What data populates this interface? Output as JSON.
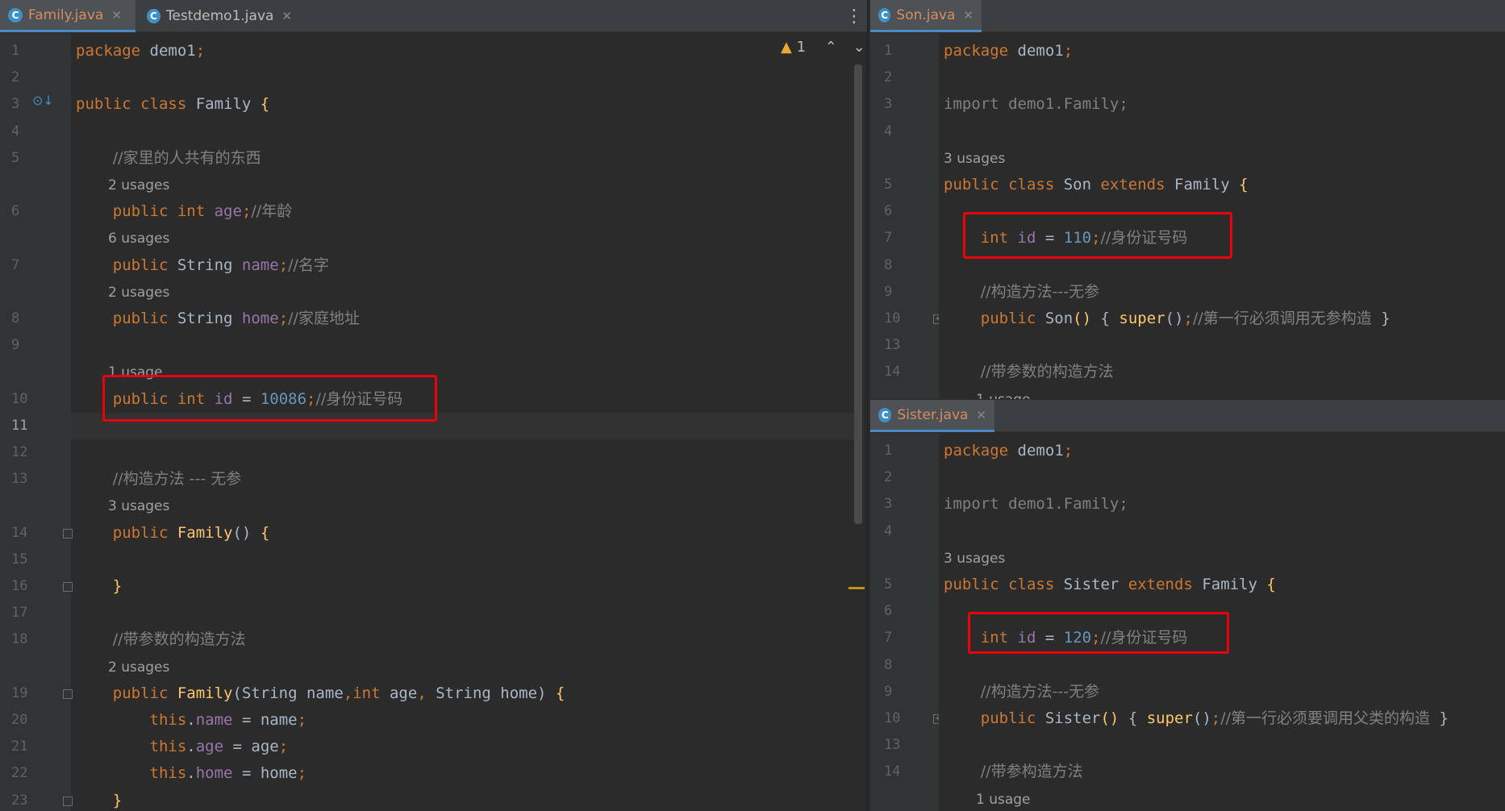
{
  "left_tabs": [
    {
      "name": "Family.java",
      "active": true
    },
    {
      "name": "Testdemo1.java",
      "active": false
    }
  ],
  "son_tab": {
    "name": "Son.java"
  },
  "sister_tab": {
    "name": "Sister.java"
  },
  "icons": {
    "tab": "java-class-icon",
    "close": "close-icon",
    "menu": "more-vertical-icon",
    "warning": "warning-icon"
  },
  "warning_count": "1",
  "family": {
    "lines": [
      {
        "n": "1",
        "code": [
          [
            "kw",
            "package "
          ],
          [
            "t",
            "demo1"
          ],
          [
            "kw",
            ";"
          ]
        ]
      },
      {
        "n": "2",
        "code": []
      },
      {
        "n": "3",
        "code": [
          [
            "kw",
            "public class "
          ],
          [
            "t",
            "Family "
          ],
          [
            "fn",
            "{"
          ]
        ]
      },
      {
        "n": "4",
        "code": []
      },
      {
        "n": "5",
        "code": [
          [
            "t",
            "    "
          ],
          [
            "cm",
            "//家里的人共有的东西"
          ]
        ]
      },
      {
        "hint": "2 usages"
      },
      {
        "n": "6",
        "code": [
          [
            "t",
            "    "
          ],
          [
            "kw",
            "public int "
          ],
          [
            "fld",
            "age"
          ],
          [
            "kw",
            ";"
          ],
          [
            "cm",
            "//年龄"
          ]
        ]
      },
      {
        "hint": "6 usages"
      },
      {
        "n": "7",
        "code": [
          [
            "t",
            "    "
          ],
          [
            "kw",
            "public "
          ],
          [
            "t",
            "String "
          ],
          [
            "fld",
            "name"
          ],
          [
            "kw",
            ";"
          ],
          [
            "cm",
            "//名字"
          ]
        ]
      },
      {
        "hint": "2 usages"
      },
      {
        "n": "8",
        "code": [
          [
            "t",
            "    "
          ],
          [
            "kw",
            "public "
          ],
          [
            "t",
            "String "
          ],
          [
            "fld",
            "home"
          ],
          [
            "kw",
            ";"
          ],
          [
            "cm",
            "//家庭地址"
          ]
        ]
      },
      {
        "n": "9",
        "code": []
      },
      {
        "hint": "1 usage"
      },
      {
        "n": "10",
        "code": [
          [
            "t",
            "    "
          ],
          [
            "kw",
            "public int "
          ],
          [
            "fld",
            "id"
          ],
          [
            "t",
            " = "
          ],
          [
            "num",
            "10086"
          ],
          [
            "kw",
            ";"
          ],
          [
            "cm",
            "//身份证号码"
          ]
        ]
      },
      {
        "n": "11",
        "code": [],
        "current": true
      },
      {
        "n": "12",
        "code": []
      },
      {
        "n": "13",
        "code": [
          [
            "t",
            "    "
          ],
          [
            "cm",
            "//构造方法 --- 无参"
          ]
        ]
      },
      {
        "hint": "3 usages"
      },
      {
        "n": "14",
        "code": [
          [
            "t",
            "    "
          ],
          [
            "kw",
            "public "
          ],
          [
            "fn",
            "Family"
          ],
          [
            "t",
            "() "
          ],
          [
            "fn",
            "{"
          ]
        ]
      },
      {
        "n": "15",
        "code": []
      },
      {
        "n": "16",
        "code": [
          [
            "t",
            "    "
          ],
          [
            "fn",
            "}"
          ]
        ]
      },
      {
        "n": "17",
        "code": []
      },
      {
        "n": "18",
        "code": [
          [
            "t",
            "    "
          ],
          [
            "cm",
            "//带参数的构造方法"
          ]
        ]
      },
      {
        "hint": "2 usages"
      },
      {
        "n": "19",
        "code": [
          [
            "t",
            "    "
          ],
          [
            "kw",
            "public "
          ],
          [
            "fn",
            "Family"
          ],
          [
            "t",
            "(String name"
          ],
          [
            "kw",
            ","
          ],
          [
            "kw",
            "int "
          ],
          [
            "t",
            "age"
          ],
          [
            "kw",
            ", "
          ],
          [
            "t",
            "String home) "
          ],
          [
            "fn",
            "{"
          ]
        ]
      },
      {
        "n": "20",
        "code": [
          [
            "t",
            "        "
          ],
          [
            "kw",
            "this"
          ],
          [
            "t",
            "."
          ],
          [
            "fld",
            "name"
          ],
          [
            "t",
            " = name"
          ],
          [
            "kw",
            ";"
          ]
        ]
      },
      {
        "n": "21",
        "code": [
          [
            "t",
            "        "
          ],
          [
            "kw",
            "this"
          ],
          [
            "t",
            "."
          ],
          [
            "fld",
            "age"
          ],
          [
            "t",
            " = age"
          ],
          [
            "kw",
            ";"
          ]
        ]
      },
      {
        "n": "22",
        "code": [
          [
            "t",
            "        "
          ],
          [
            "kw",
            "this"
          ],
          [
            "t",
            "."
          ],
          [
            "fld",
            "home"
          ],
          [
            "t",
            " = home"
          ],
          [
            "kw",
            ";"
          ]
        ]
      },
      {
        "n": "23",
        "code": [
          [
            "t",
            "    "
          ],
          [
            "fn",
            "}"
          ]
        ]
      }
    ]
  },
  "son": {
    "lines": [
      {
        "n": "1",
        "code": [
          [
            "kw",
            "package "
          ],
          [
            "t",
            "demo1"
          ],
          [
            "kw",
            ";"
          ]
        ]
      },
      {
        "n": "2",
        "code": []
      },
      {
        "n": "3",
        "code": [
          [
            "cm2",
            "import demo1.Family;"
          ]
        ]
      },
      {
        "n": "4",
        "code": []
      },
      {
        "hint": "3 usages"
      },
      {
        "n": "5",
        "code": [
          [
            "kw",
            "public class "
          ],
          [
            "t",
            "Son "
          ],
          [
            "kw",
            "extends "
          ],
          [
            "t",
            "Family "
          ],
          [
            "fn",
            "{"
          ]
        ]
      },
      {
        "n": "6",
        "code": []
      },
      {
        "n": "7",
        "code": [
          [
            "t",
            "    "
          ],
          [
            "kw",
            "int "
          ],
          [
            "fld",
            "id"
          ],
          [
            "t",
            " = "
          ],
          [
            "num",
            "110"
          ],
          [
            "kw",
            ";"
          ],
          [
            "cm",
            "//身份证号码"
          ]
        ]
      },
      {
        "n": "8",
        "code": []
      },
      {
        "n": "9",
        "code": [
          [
            "t",
            "    "
          ],
          [
            "cm",
            "//构造方法---无参"
          ]
        ]
      },
      {
        "n": "10",
        "code": [
          [
            "t",
            "    "
          ],
          [
            "kw",
            "public "
          ],
          [
            "t",
            "Son"
          ],
          [
            "fn",
            "()"
          ],
          [
            "t",
            " { "
          ],
          [
            "fn",
            "super"
          ],
          [
            "t",
            "()"
          ],
          [
            "kw",
            ";"
          ],
          [
            "cm",
            "//第一行必须调用无参构造"
          ],
          [
            "t",
            " }"
          ]
        ]
      },
      {
        "n": "13",
        "code": []
      },
      {
        "n": "14",
        "code": [
          [
            "t",
            "    "
          ],
          [
            "cm",
            "//带参数的构造方法"
          ]
        ]
      },
      {
        "hint": "1 usage"
      }
    ]
  },
  "sister": {
    "lines": [
      {
        "n": "1",
        "code": [
          [
            "kw",
            "package "
          ],
          [
            "t",
            "demo1"
          ],
          [
            "kw",
            ";"
          ]
        ]
      },
      {
        "n": "2",
        "code": []
      },
      {
        "n": "3",
        "code": [
          [
            "cm2",
            "import demo1.Family;"
          ]
        ]
      },
      {
        "n": "4",
        "code": []
      },
      {
        "hint": "3 usages"
      },
      {
        "n": "5",
        "code": [
          [
            "kw",
            "public class "
          ],
          [
            "t",
            "Sister "
          ],
          [
            "kw",
            "extends "
          ],
          [
            "t",
            "Family "
          ],
          [
            "fn",
            "{"
          ]
        ]
      },
      {
        "n": "6",
        "code": []
      },
      {
        "n": "7",
        "code": [
          [
            "t",
            "    "
          ],
          [
            "kw",
            "int "
          ],
          [
            "fld",
            "id"
          ],
          [
            "t",
            " = "
          ],
          [
            "num",
            "120"
          ],
          [
            "kw",
            ";"
          ],
          [
            "cm",
            "//身份证号码"
          ]
        ]
      },
      {
        "n": "8",
        "code": []
      },
      {
        "n": "9",
        "code": [
          [
            "t",
            "    "
          ],
          [
            "cm",
            "//构造方法---无参"
          ]
        ]
      },
      {
        "n": "10",
        "code": [
          [
            "t",
            "    "
          ],
          [
            "kw",
            "public "
          ],
          [
            "t",
            "Sister"
          ],
          [
            "fn",
            "()"
          ],
          [
            "t",
            " { "
          ],
          [
            "fn",
            "super"
          ],
          [
            "t",
            "()"
          ],
          [
            "kw",
            ";"
          ],
          [
            "cm",
            "//第一行必须要调用父类的构造"
          ],
          [
            "t",
            " }"
          ]
        ]
      },
      {
        "n": "13",
        "code": []
      },
      {
        "n": "14",
        "code": [
          [
            "t",
            "    "
          ],
          [
            "cm",
            "//带参构造方法"
          ]
        ]
      },
      {
        "hint": "1 usage"
      }
    ]
  },
  "colors": {
    "keyword": "#cc7832",
    "comment": "#808080",
    "number": "#6897bb",
    "field": "#9876aa",
    "function": "#ffc66d",
    "highlight_box": "#e8000b"
  }
}
